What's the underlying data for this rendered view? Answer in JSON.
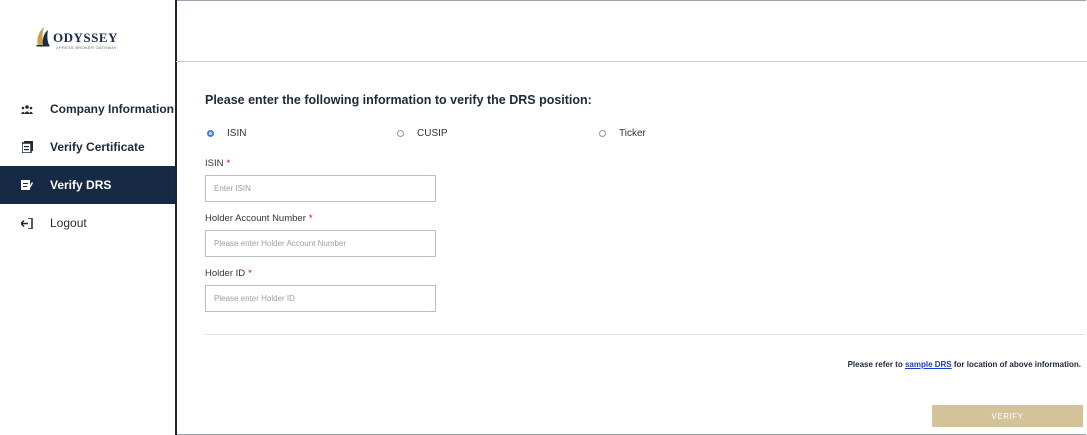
{
  "brand": {
    "name": "ODYSSEY",
    "tagline": "XPRESS BROKER GATEWAY"
  },
  "sidebar": {
    "items": [
      {
        "label": "Company Information",
        "icon": "users-icon"
      },
      {
        "label": "Verify Certificate",
        "icon": "certificate-icon"
      },
      {
        "label": "Verify DRS",
        "icon": "verify-drs-icon",
        "active": true
      },
      {
        "label": "Logout",
        "icon": "logout-icon"
      }
    ]
  },
  "main": {
    "heading": "Please enter the following information to verify the DRS position:",
    "radios": [
      {
        "label": "ISIN",
        "selected": true
      },
      {
        "label": "CUSIP",
        "selected": false
      },
      {
        "label": "Ticker",
        "selected": false
      }
    ],
    "fields": {
      "isin": {
        "label": "ISIN",
        "placeholder": "Enter ISIN",
        "value": ""
      },
      "holder_account": {
        "label": "Holder Account Number",
        "placeholder": "Please enter Holder Account Number",
        "value": ""
      },
      "holder_id": {
        "label": "Holder ID",
        "placeholder": "Please enter Holder ID",
        "value": ""
      }
    },
    "required_mark": "*",
    "refer": {
      "prefix": "Please refer to",
      "link": "sample DRS",
      "suffix": "for location of above information."
    },
    "verify_label": "VERIFY"
  },
  "colors": {
    "sidebar_active": "#172a45",
    "verify_button": "#d4c29a",
    "required": "#d0021b",
    "link": "#1a3cc9"
  }
}
